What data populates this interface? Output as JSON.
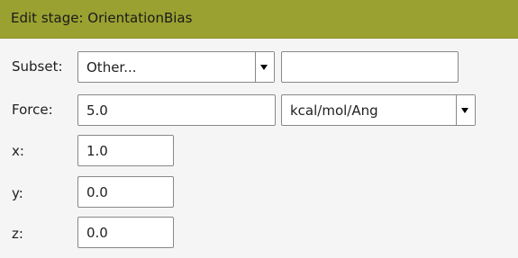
{
  "dialog": {
    "title": "Edit stage: OrientationBias"
  },
  "fields": {
    "subset": {
      "label": "Subset:",
      "selected": "Other...",
      "text_value": ""
    },
    "force": {
      "label": "Force:",
      "value": "5.0",
      "unit_selected": "kcal/mol/Ang"
    },
    "x": {
      "label": "x:",
      "value": "1.0"
    },
    "y": {
      "label": "y:",
      "value": "0.0"
    },
    "z": {
      "label": "z:",
      "value": "0.0"
    }
  }
}
